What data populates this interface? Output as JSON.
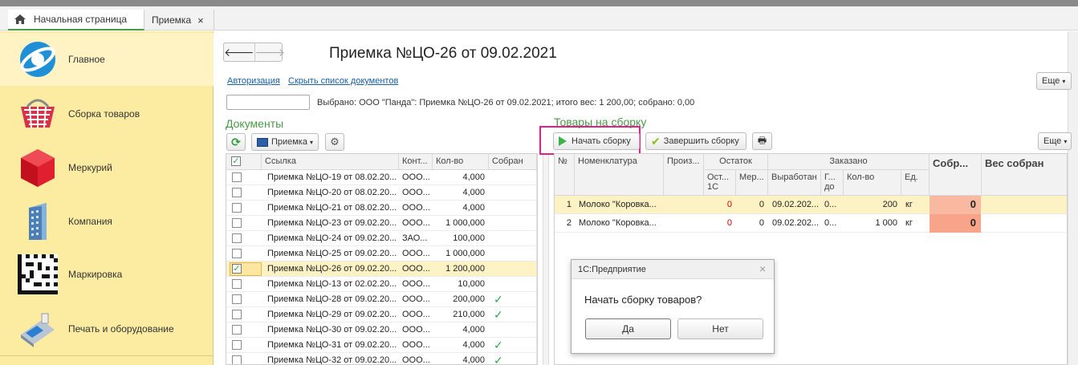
{
  "tabs": [
    {
      "label": "Начальная страница"
    },
    {
      "label": "Приемка"
    }
  ],
  "tab_close": "×",
  "sidebar": [
    {
      "label": "Главное"
    },
    {
      "label": "Сборка товаров"
    },
    {
      "label": "Меркурий"
    },
    {
      "label": "Компания"
    },
    {
      "label": "Маркировка"
    },
    {
      "label": "Печать и оборудование"
    }
  ],
  "nav": {
    "back": "🡐",
    "forward": "🡒"
  },
  "title": "Приемка №ЦО-26 от 09.02.2021",
  "links": {
    "auth": "Авторизация",
    "hide": "Скрыть список документов"
  },
  "more": "Еще",
  "selected_info": "Выбрано: ООО \"Панда\": Приемка №ЦО-26 от 09.02.2021; итого вес: 1 200,00; собрано: 0,00",
  "search_value": "",
  "docs": {
    "title": "Документы",
    "filter": "Приемка",
    "headers": {
      "link": "Ссылка",
      "contr": "Конт...",
      "qty": "Кол-во",
      "collected": "Собран"
    },
    "rows": [
      {
        "link": "Приемка №ЦО-19 от 08.02.20...",
        "contr": "ООО...",
        "qty": "4,000",
        "checked": false,
        "done": false
      },
      {
        "link": "Приемка №ЦО-20 от 08.02.20...",
        "contr": "ООО...",
        "qty": "4,000",
        "checked": false,
        "done": false
      },
      {
        "link": "Приемка №ЦО-21 от 08.02.20...",
        "contr": "ООО...",
        "qty": "4,000",
        "checked": false,
        "done": false
      },
      {
        "link": "Приемка №ЦО-23 от 09.02.20...",
        "contr": "ООО...",
        "qty": "1 000,000",
        "checked": false,
        "done": false
      },
      {
        "link": "Приемка №ЦО-24 от 09.02.20...",
        "contr": "ЗАО...",
        "qty": "100,000",
        "checked": false,
        "done": false
      },
      {
        "link": "Приемка №ЦО-25 от 09.02.20...",
        "contr": "ООО...",
        "qty": "1 000,000",
        "checked": false,
        "done": false
      },
      {
        "link": "Приемка №ЦО-26 от 09.02.20...",
        "contr": "ООО...",
        "qty": "1 200,000",
        "checked": true,
        "done": false
      },
      {
        "link": "Приемка №ЦО-13 от 02.02.20...",
        "contr": "ООО...",
        "qty": "10,000",
        "checked": false,
        "done": false
      },
      {
        "link": "Приемка №ЦО-28 от 09.02.20...",
        "contr": "ООО...",
        "qty": "200,000",
        "checked": false,
        "done": true
      },
      {
        "link": "Приемка №ЦО-29 от 09.02.20...",
        "contr": "ООО...",
        "qty": "210,000",
        "checked": false,
        "done": true
      },
      {
        "link": "Приемка №ЦО-30 от 09.02.20...",
        "contr": "ООО...",
        "qty": "4,000",
        "checked": false,
        "done": false
      },
      {
        "link": "Приемка №ЦО-31 от 09.02.20...",
        "contr": "ООО...",
        "qty": "4,000",
        "checked": false,
        "done": true
      },
      {
        "link": "Приемка №ЦО-32 от 09.02.20...",
        "contr": "ООО...",
        "qty": "4,000",
        "checked": false,
        "done": true
      }
    ]
  },
  "goods": {
    "title": "Товары на сборку",
    "btn_start": "Начать сборку",
    "btn_finish": "Завершить сборку",
    "headers": {
      "n": "№",
      "nom": "Номенклатура",
      "prod": "Произ...",
      "rest": "Остаток",
      "rest1c": "Ост... 1С",
      "mer": "Мер...",
      "ordered": "Заказано",
      "made": "Выработан",
      "g": "Г... до",
      "qty": "Кол-во",
      "unit": "Ед.",
      "coll": "Собр...",
      "wcoll": "Вес собран"
    },
    "rows": [
      {
        "n": "1",
        "nom": "Молоко \"Коровка...",
        "rest1c": "0",
        "mer": "0",
        "made": "09.02.202...",
        "g": "0...",
        "qty": "200",
        "unit": "кг",
        "coll": "0"
      },
      {
        "n": "2",
        "nom": "Молоко \"Коровка...",
        "rest1c": "0",
        "mer": "0",
        "made": "09.02.202...",
        "g": "0...",
        "qty": "1 000",
        "unit": "кг",
        "coll": "0"
      }
    ]
  },
  "dialog": {
    "title": "1С:Предприятие",
    "message": "Начать сборку товаров?",
    "yes": "Да",
    "no": "Нет",
    "close": "×"
  },
  "colors": {
    "accent": "#4a9a47",
    "highlight": "#e0218a",
    "sidebar": "#fbeca2",
    "coll_cell": "#f7a48a"
  }
}
